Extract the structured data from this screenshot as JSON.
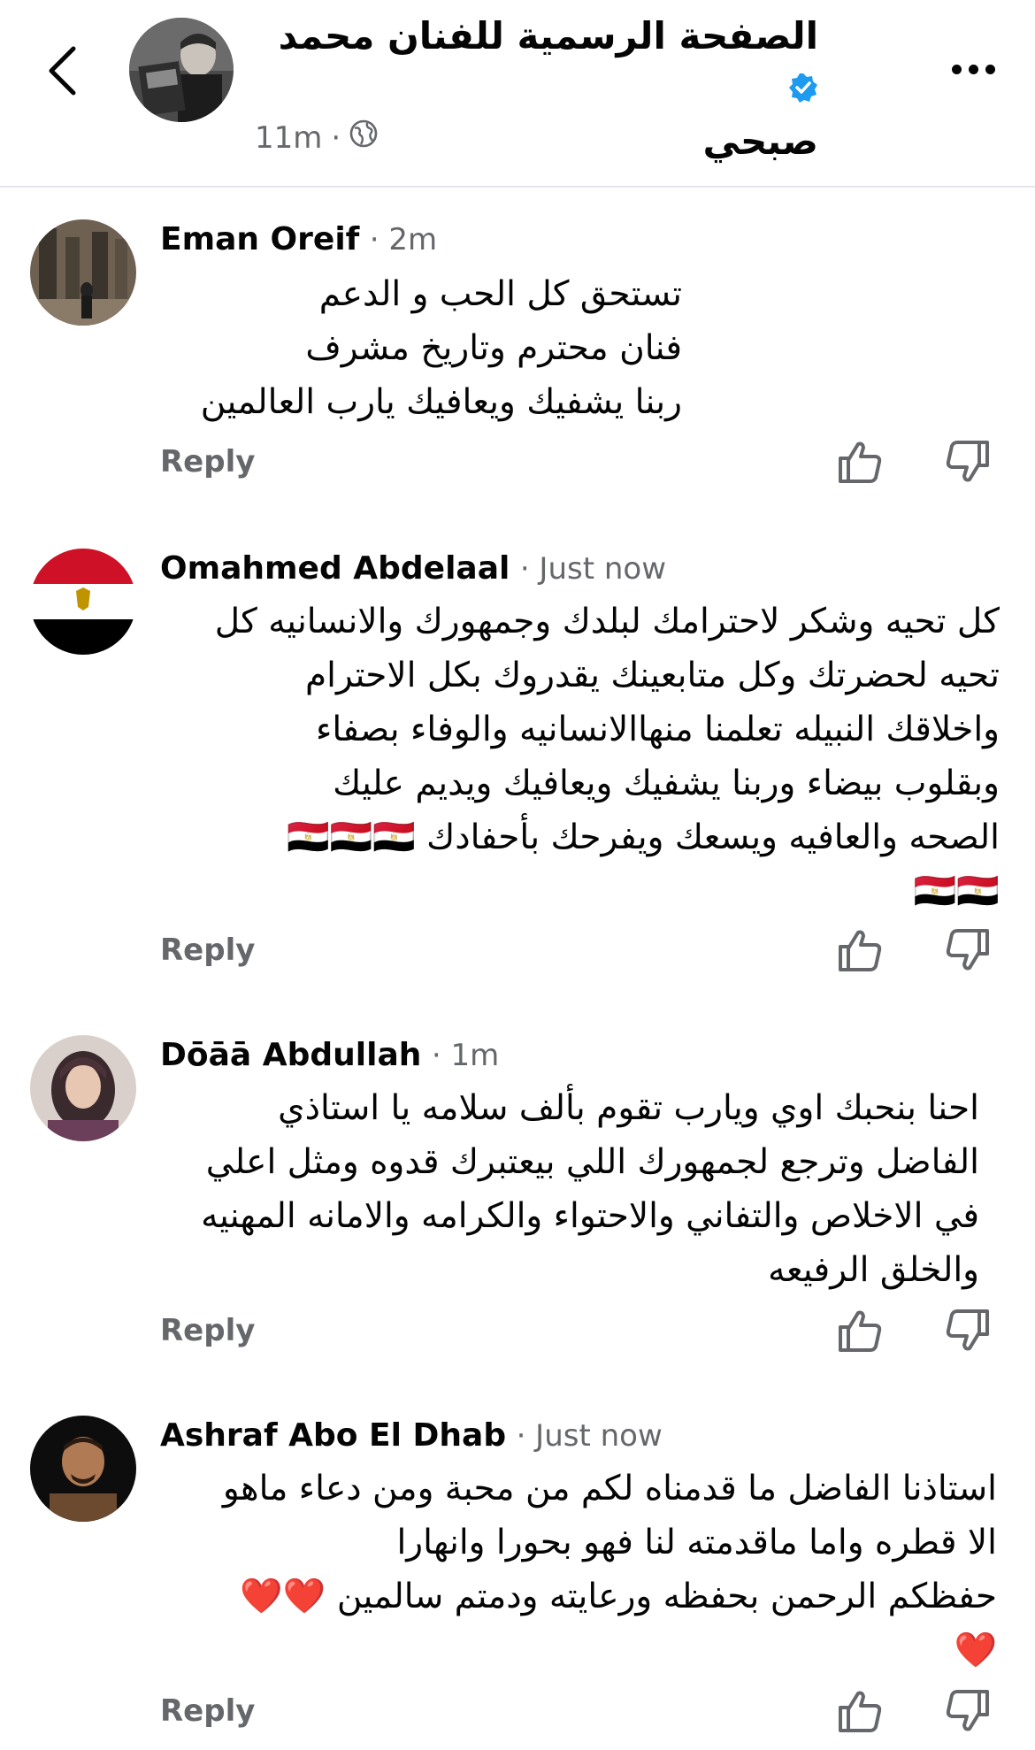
{
  "header": {
    "title_line1": "الصفحة الرسمية للفنان محمد",
    "title_line2": "صبحي",
    "time": "11m",
    "separator": "·"
  },
  "comments": [
    {
      "author": "Eman Oreif",
      "time": "· 2m",
      "lines": [
        "تستحق كل الحب و الدعم",
        "فنان محترم وتاريخ مشرف",
        "ربنا يشفيك ويعافيك يارب العالمين"
      ],
      "reply": "Reply"
    },
    {
      "author": "Omahmed Abdelaal",
      "time": "· Just now",
      "lines": [
        "كل تحيه وشكر لاحترامك لبلدك وجمهورك والانسانيه كل",
        "تحيه لحضرتك وكل متابعينك يقدروك بكل الاحترام",
        "واخلاقك النبيله تعلمنا منهاالانسانيه والوفاء بصفاء",
        "وبقلوب بيضاء وربنا يشفيك ويعافيك ويديم عليك",
        "الصحه والعافيه ويسعك ويفرحك بأحفادك 🇪🇬🇪🇬🇪🇬",
        "🇪🇬🇪🇬"
      ],
      "reply": "Reply"
    },
    {
      "author": "Dōāā Abdullah",
      "time": "· 1m",
      "lines": [
        "احنا بنحبك اوي ويارب تقوم بألف سلامه يا استاذي",
        "الفاضل وترجع لجمهورك اللي بيعتبرك قدوه ومثل اعلي",
        "في الاخلاص والتفاني والاحتواء والكرامه والامانه المهنيه",
        "والخلق الرفيعه"
      ],
      "reply": "Reply"
    },
    {
      "author": "Ashraf Abo El Dhab",
      "time": "· Just now",
      "lines": [
        "استاذنا الفاضل ما قدمناه لكم من محبة ومن دعاء ماهو",
        "الا قطره واما ماقدمته لنا فهو بحورا وانهارا",
        "حفظكم الرحمن بحفظه ورعايته ودمتم سالمين ❤️❤️",
        "❤️"
      ],
      "reply": "Reply"
    }
  ],
  "icons": {
    "back": "chevron-left-icon",
    "verified": "verified-badge-icon",
    "globe": "globe-icon",
    "more": "more-horizontal-icon",
    "like": "thumbs-up-icon",
    "dislike": "thumbs-down-icon"
  },
  "colors": {
    "verified": "#1d9bf0",
    "muted_text": "#65676b",
    "divider": "#e4e6eb"
  }
}
